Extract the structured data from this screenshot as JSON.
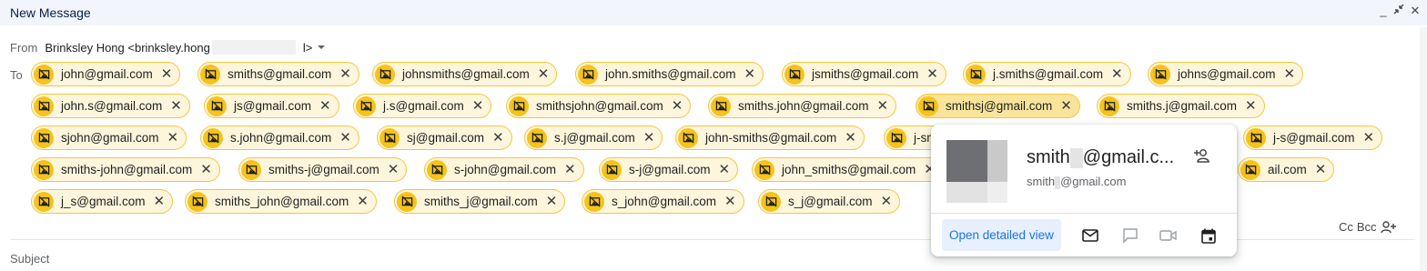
{
  "window": {
    "title": "New Message",
    "controls": [
      "minimize-icon",
      "exit-fullscreen-icon",
      "close-icon"
    ]
  },
  "from": {
    "label": "From",
    "value": "Brinksley Hong <brinksley.hong",
    "suffix": "l>"
  },
  "to": {
    "label": "To",
    "recipients": [
      "john@gmail.com",
      "smiths@gmail.com",
      "johnsmiths@gmail.com",
      "john.smiths@gmail.com",
      "jsmiths@gmail.com",
      "j.smiths@gmail.com",
      "johns@gmail.com",
      "john.s@gmail.com",
      "js@gmail.com",
      "j.s@gmail.com",
      "smithsjohn@gmail.com",
      "smiths.john@gmail.com",
      "smithsj@gmail.com",
      "smiths.j@gmail.com",
      "sjohn@gmail.com",
      "s.john@gmail.com",
      "sj@gmail.com",
      "s.j@gmail.com",
      "john-smiths@gmail.com",
      "j-sm",
      "j-s@gmail.com",
      "smiths-john@gmail.com",
      "smiths-j@gmail.com",
      "s-john@gmail.com",
      "s-j@gmail.com",
      "john_smiths@gmail.com",
      "ail.com",
      "j_s@gmail.com",
      "smiths_john@gmail.com",
      "smiths_j@gmail.com",
      "s_john@gmail.com",
      "s_j@gmail.com"
    ]
  },
  "cc_bcc": {
    "cc": "Cc",
    "bcc": "Bcc"
  },
  "subject": {
    "placeholder": "Subject"
  },
  "contact_card": {
    "name_start": "smith",
    "name_end": "@gmail.c...",
    "email_start": "smith",
    "email_end": "@gmail.com",
    "open_button": "Open detailed view",
    "actions": [
      "mail-icon",
      "chat-icon",
      "video-call-icon",
      "calendar-icon"
    ]
  },
  "colors": {
    "chip_border": "#f5c63a",
    "chip_bg": "#fdf6dd",
    "avatar_bg": "#f5c31a",
    "link_blue": "#1a73e8"
  }
}
